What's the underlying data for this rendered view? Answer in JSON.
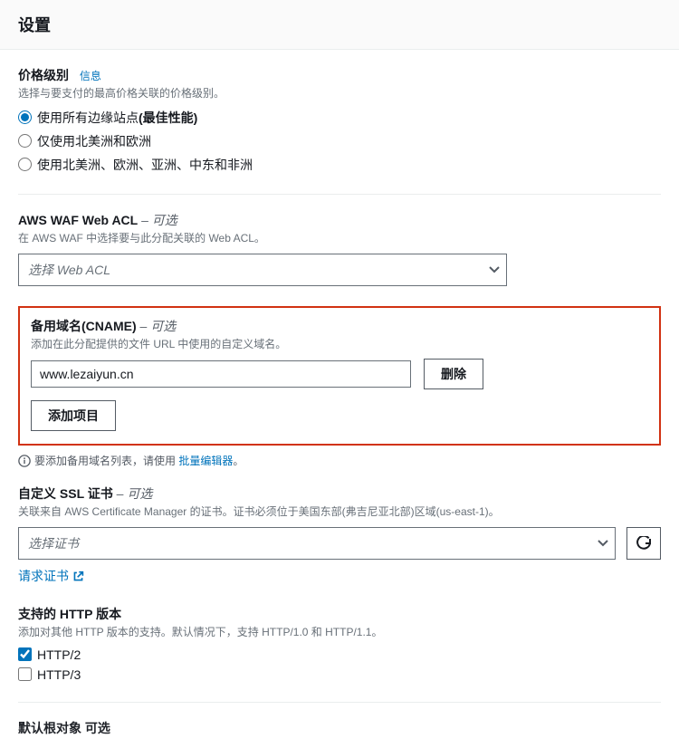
{
  "header": {
    "title": "设置"
  },
  "price": {
    "title": "价格级别",
    "info": "信息",
    "desc": "选择与要支付的最高价格关联的价格级别。",
    "options": [
      {
        "label": "使用所有边缘站点",
        "suffix": "(最佳性能)"
      },
      {
        "label": "仅使用北美洲和欧洲"
      },
      {
        "label": "使用北美洲、欧洲、亚洲、中东和非洲"
      }
    ]
  },
  "waf": {
    "title": "AWS WAF Web ACL",
    "optional": " – 可选",
    "desc": "在 AWS WAF 中选择要与此分配关联的 Web ACL。",
    "placeholder": "选择 Web ACL"
  },
  "cname": {
    "title": "备用域名(CNAME)",
    "optional": " – 可选",
    "desc": "添加在此分配提供的文件 URL 中使用的自定义域名。",
    "value": "www.lezaiyun.cn",
    "deleteLabel": "删除",
    "addLabel": "添加项目",
    "hintPrefix": "要添加备用域名列表，请使用 ",
    "hintLink": "批量编辑器",
    "hintSuffix": "。"
  },
  "ssl": {
    "title": "自定义 SSL 证书",
    "optional": " – 可选",
    "desc": "关联来自 AWS Certificate Manager 的证书。证书必须位于美国东部(弗吉尼亚北部)区域(us-east-1)。",
    "placeholder": "选择证书",
    "requestLabel": "请求证书"
  },
  "http": {
    "title": "支持的 HTTP 版本",
    "desc": "添加对其他 HTTP 版本的支持。默认情况下，支持 HTTP/1.0 和 HTTP/1.1。",
    "options": [
      {
        "label": "HTTP/2",
        "checked": true
      },
      {
        "label": "HTTP/3",
        "checked": false
      }
    ]
  },
  "root": {
    "titleFragment": "默认根对象   可选"
  }
}
